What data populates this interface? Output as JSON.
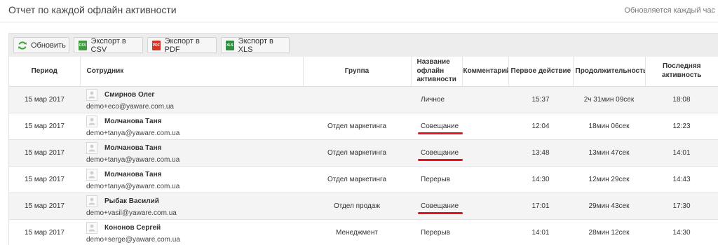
{
  "header": {
    "title": "Отчет по каждой офлайн активности",
    "update_note": "Обновляется каждый час"
  },
  "toolbar": {
    "refresh_label": "Обновить",
    "csv_label": "Экспорт в CSV",
    "pdf_label": "Экспорт в PDF",
    "xls_label": "Экспорт в XLS"
  },
  "colors": {
    "refresh_icon": "#3aa33a",
    "csv_icon": "#3f9c3f",
    "pdf_icon": "#d9322b",
    "xls_icon": "#2e8f3e",
    "highlight_underline": "#e3141e"
  },
  "table": {
    "headers": {
      "period": "Период",
      "employee": "Сотрудник",
      "group": "Группа",
      "activity": "Название офлайн активности",
      "comment": "Комментарий",
      "first_action": "Первое действие",
      "duration": "Продолжительность",
      "last_activity": "Последняя активность"
    },
    "rows": [
      {
        "period": "15 мар 2017",
        "name": "Смирнов Олег",
        "email": "demo+eco@yaware.com.ua",
        "group": "",
        "activity": "Личное",
        "comment": "",
        "first": "15:37",
        "duration": "2ч 31мин 09сек",
        "last": "18:08"
      },
      {
        "period": "15 мар 2017",
        "name": "Молчанова Таня",
        "email": "demo+tanya@yaware.com.ua",
        "group": "Отдел маркетинга",
        "activity": "Совещание",
        "comment": "",
        "first": "12:04",
        "duration": "18мин 06сек",
        "last": "12:23"
      },
      {
        "period": "15 мар 2017",
        "name": "Молчанова Таня",
        "email": "demo+tanya@yaware.com.ua",
        "group": "Отдел маркетинга",
        "activity": "Совещание",
        "comment": "",
        "first": "13:48",
        "duration": "13мин 47сек",
        "last": "14:01"
      },
      {
        "period": "15 мар 2017",
        "name": "Молчанова Таня",
        "email": "demo+tanya@yaware.com.ua",
        "group": "Отдел маркетинга",
        "activity": "Перерыв",
        "comment": "",
        "first": "14:30",
        "duration": "12мин 29сек",
        "last": "14:43"
      },
      {
        "period": "15 мар 2017",
        "name": "Рыбак Василий",
        "email": "demo+vasil@yaware.com.ua",
        "group": "Отдел продаж",
        "activity": "Совещание",
        "comment": "",
        "first": "17:01",
        "duration": "29мин 43сек",
        "last": "17:30"
      },
      {
        "period": "15 мар 2017",
        "name": "Кононов Сергей",
        "email": "demo+serge@yaware.com.ua",
        "group": "Менеджмент",
        "activity": "Перерыв",
        "comment": "",
        "first": "14:01",
        "duration": "28мин 12сек",
        "last": "14:30"
      }
    ]
  }
}
